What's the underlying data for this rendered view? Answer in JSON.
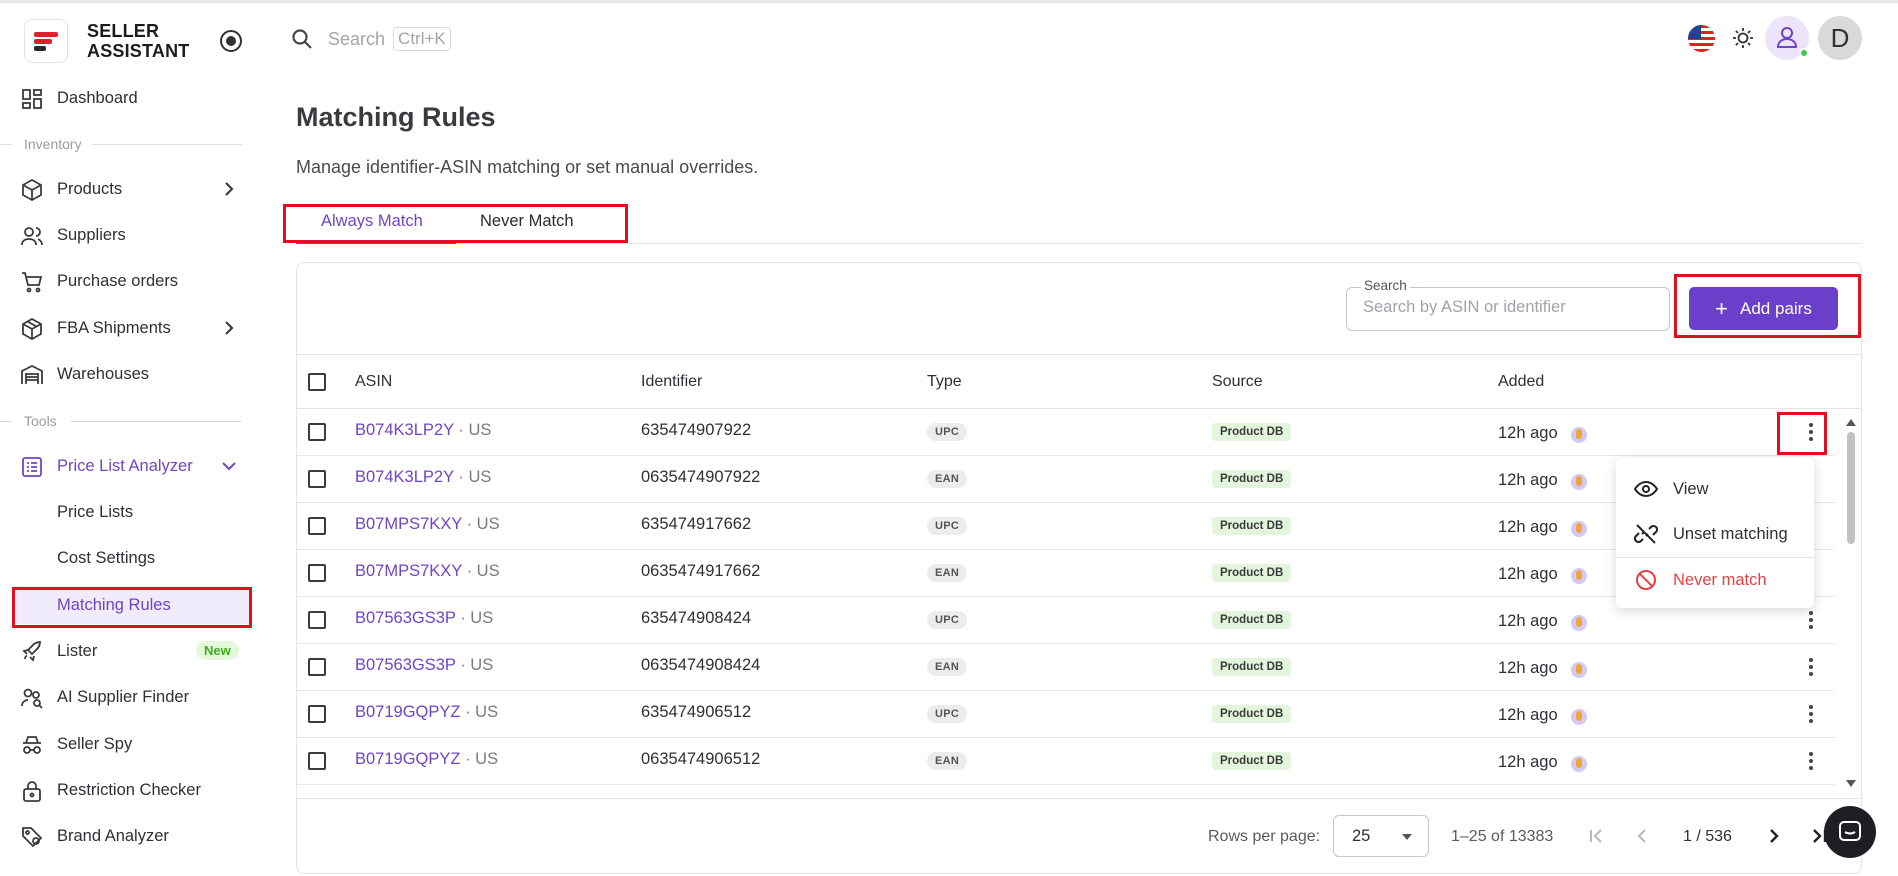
{
  "app": {
    "brand_line1": "SELLER",
    "brand_line2": "ASSISTANT",
    "accent_color": "#7044c6",
    "logo_colors": [
      "#e0202c",
      "#2b2b2b"
    ]
  },
  "header": {
    "search_placeholder": "Search",
    "search_shortcut": "Ctrl+K",
    "avatar_letter": "D",
    "icons": [
      "search-icon",
      "us-flag-icon",
      "theme-sun-icon",
      "user-icon"
    ]
  },
  "sidebar": {
    "dashboard": "Dashboard",
    "section_inventory": "Inventory",
    "products": "Products",
    "suppliers": "Suppliers",
    "purchase_orders": "Purchase orders",
    "fba_shipments": "FBA Shipments",
    "warehouses": "Warehouses",
    "section_tools": "Tools",
    "price_list_analyzer": "Price List Analyzer",
    "price_lists": "Price Lists",
    "cost_settings": "Cost Settings",
    "matching_rules": "Matching Rules",
    "lister": "Lister",
    "lister_badge": "New",
    "ai_supplier_finder": "AI Supplier Finder",
    "seller_spy": "Seller Spy",
    "restriction_checker": "Restriction Checker",
    "brand_analyzer": "Brand Analyzer"
  },
  "page": {
    "title": "Matching Rules",
    "subtitle": "Manage identifier-ASIN matching or set manual overrides.",
    "tabs": [
      {
        "label": "Always Match",
        "active": true
      },
      {
        "label": "Never Match",
        "active": false
      }
    ]
  },
  "toolbar": {
    "search_label": "Search",
    "search_placeholder": "Search by ASIN or identifier",
    "add_button": "Add pairs"
  },
  "table": {
    "headers": [
      "ASIN",
      "Identifier",
      "Type",
      "Source",
      "Added"
    ],
    "rows": [
      {
        "asin": "B074K3LP2Y",
        "market": " · US",
        "identifier": "635474907922",
        "type": "UPC",
        "source": "Product DB",
        "added": "12h ago"
      },
      {
        "asin": "B074K3LP2Y",
        "market": " · US",
        "identifier": "0635474907922",
        "type": "EAN",
        "source": "Product DB",
        "added": "12h ago"
      },
      {
        "asin": "B07MPS7KXY",
        "market": " · US",
        "identifier": "635474917662",
        "type": "UPC",
        "source": "Product DB",
        "added": "12h ago"
      },
      {
        "asin": "B07MPS7KXY",
        "market": " · US",
        "identifier": "0635474917662",
        "type": "EAN",
        "source": "Product DB",
        "added": "12h ago"
      },
      {
        "asin": "B07563GS3P",
        "market": " · US",
        "identifier": "635474908424",
        "type": "UPC",
        "source": "Product DB",
        "added": "12h ago"
      },
      {
        "asin": "B07563GS3P",
        "market": " · US",
        "identifier": "0635474908424",
        "type": "EAN",
        "source": "Product DB",
        "added": "12h ago"
      },
      {
        "asin": "B0719GQPYZ",
        "market": " · US",
        "identifier": "635474906512",
        "type": "UPC",
        "source": "Product DB",
        "added": "12h ago"
      },
      {
        "asin": "B0719GQPYZ",
        "market": " · US",
        "identifier": "0635474906512",
        "type": "EAN",
        "source": "Product DB",
        "added": "12h ago"
      }
    ]
  },
  "context_menu": {
    "items": [
      {
        "label": "View",
        "icon": "eye-icon"
      },
      {
        "label": "Unset matching",
        "icon": "unlink-icon"
      },
      {
        "label": "Never match",
        "icon": "block-icon"
      }
    ]
  },
  "footer": {
    "rows_per_page_label": "Rows per page:",
    "rows_per_page_value": "25",
    "range_text": "1–25 of 13383",
    "page_indicator": "1 / 536"
  }
}
